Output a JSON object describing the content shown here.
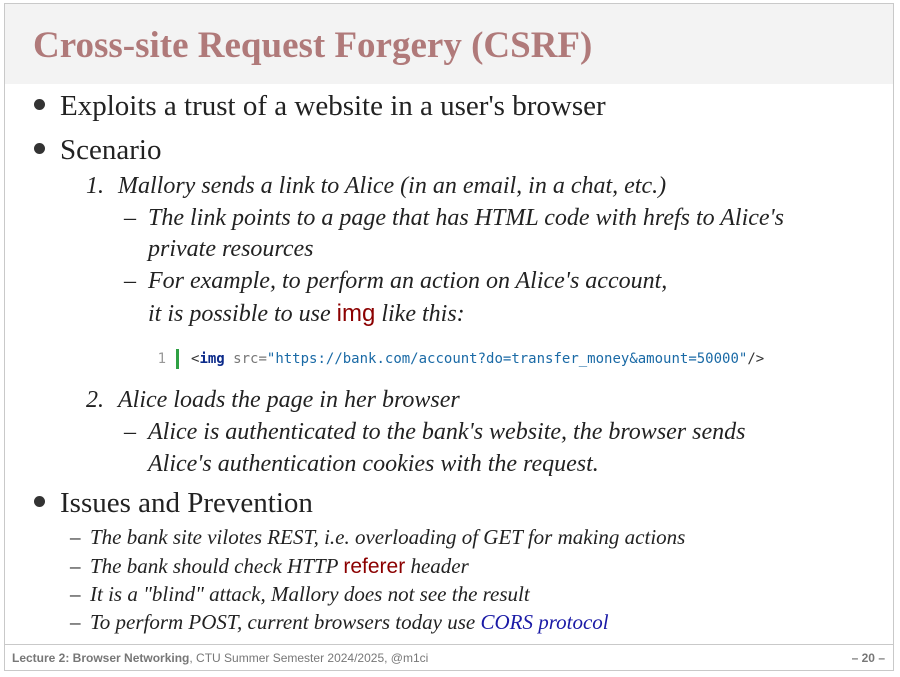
{
  "slide": {
    "title": "Cross-site Request Forgery (CSRF)",
    "bullets": {
      "b1": "Exploits a trust of a website in a user's browser",
      "b2": "Scenario",
      "b3": "Issues and Prevention"
    },
    "steps": {
      "s1_num": "1.",
      "s1_text": "Mallory sends a link to Alice (in an email, in a chat, etc.)",
      "s1_sub1_line1": "The link points to a page that has HTML code with hrefs to Alice's",
      "s1_sub1_line2": "private resources",
      "s1_sub2_line1": "For example, to perform an action on Alice's account,",
      "s1_sub2_line2_pre": "it is possible to use ",
      "s1_sub2_line2_code": "img",
      "s1_sub2_line2_post": " like this:",
      "s2_num": "2.",
      "s2_text": "Alice loads the page in her browser",
      "s2_sub1_line1": "Alice is authenticated to the bank's website, the browser sends",
      "s2_sub1_line2": "Alice's authentication cookies with the request."
    },
    "code": {
      "line_number": "1",
      "open": "<",
      "tag": "img",
      "attr": " src=",
      "value": "\"https://bank.com/account?do=transfer_money&amount=50000\"",
      "close": "/>"
    },
    "issues": {
      "i1": "The bank site vilotes REST, i.e. overloading of GET for making actions",
      "i2_pre": "The bank should check HTTP ",
      "i2_code": "referer",
      "i2_post": " header",
      "i3": "It is a \"blind\" attack, Mallory does not see the result",
      "i4_pre": "To perform POST, current browsers today use ",
      "i4_link": "CORS protocol"
    },
    "dash": "–"
  },
  "footer": {
    "lecture": "Lecture 2: Browser Networking",
    "course": ", CTU Summer Semester 2024/2025,  @m1ci",
    "page": "– 20 –"
  }
}
